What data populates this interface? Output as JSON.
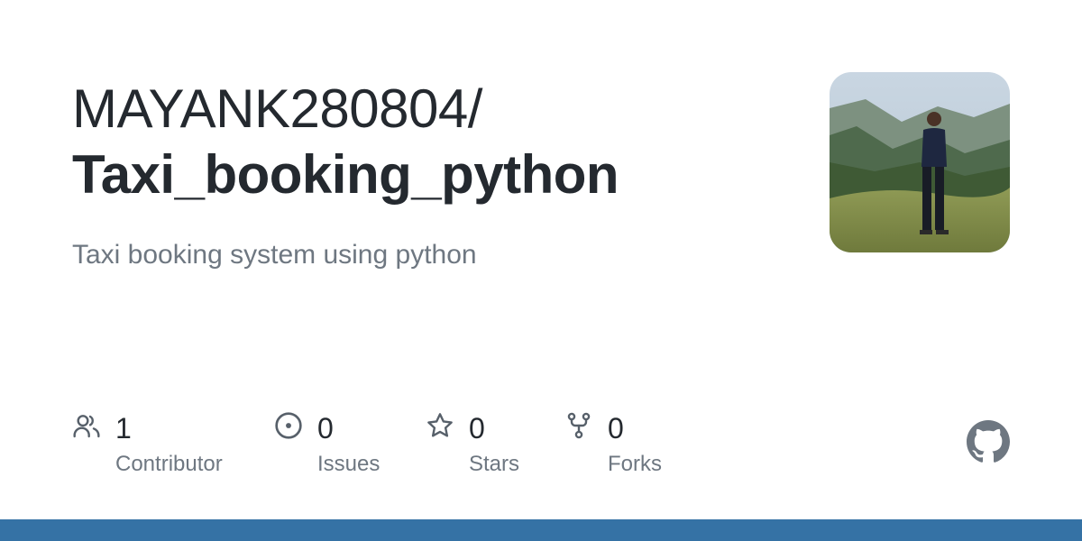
{
  "repo": {
    "owner": "MAYANK280804/",
    "name": "Taxi_booking_python",
    "description": "Taxi booking system using python"
  },
  "stats": [
    {
      "icon": "people-icon",
      "count": "1",
      "label": "Contributor"
    },
    {
      "icon": "issue-opened-icon",
      "count": "0",
      "label": "Issues"
    },
    {
      "icon": "star-icon",
      "count": "0",
      "label": "Stars"
    },
    {
      "icon": "repo-forked-icon",
      "count": "0",
      "label": "Forks"
    }
  ],
  "avatar": {
    "icon": "owner-avatar-photo"
  },
  "branding": {
    "icon": "github-mark-icon"
  },
  "colors": {
    "title": "#24292f",
    "muted": "#6e7781",
    "icon": "#57606a",
    "bottom_bar": "#3572A5"
  }
}
